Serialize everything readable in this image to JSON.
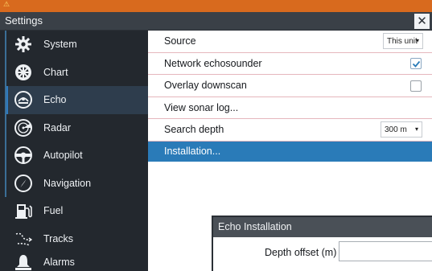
{
  "window": {
    "title": "Settings",
    "close_glyph": "✕",
    "warning_glyph": "⚠"
  },
  "sidebar": {
    "items": [
      {
        "label": "System",
        "icon": "gear-icon"
      },
      {
        "label": "Chart",
        "icon": "ship-wheel-icon"
      },
      {
        "label": "Echo",
        "icon": "echo-icon",
        "active": true
      },
      {
        "label": "Radar",
        "icon": "radar-icon"
      },
      {
        "label": "Autopilot",
        "icon": "autopilot-icon"
      },
      {
        "label": "Navigation",
        "icon": "compass-icon"
      },
      {
        "label": "Fuel",
        "icon": "fuel-pump-icon"
      },
      {
        "label": "Tracks",
        "icon": "tracks-icon"
      },
      {
        "label": "Alarms",
        "icon": "bell-icon"
      }
    ]
  },
  "settings": {
    "source": {
      "label": "Source",
      "value": "This unit"
    },
    "network_echosounder": {
      "label": "Network echosounder",
      "checked": true
    },
    "overlay_downscan": {
      "label": "Overlay downscan",
      "checked": false
    },
    "view_sonar_log": {
      "label": "View sonar log..."
    },
    "search_depth": {
      "label": "Search depth",
      "value": "300 m"
    },
    "installation": {
      "label": "Installation..."
    }
  },
  "dialog": {
    "title": "Echo Installation",
    "depth_offset_label": "Depth offset (m)",
    "depth_offset_value": ""
  },
  "colors": {
    "accent": "#2a7bb8",
    "title_strip": "#d86a1e",
    "sidebar_bg": "#23282e",
    "divider": "#e6b7bd"
  }
}
